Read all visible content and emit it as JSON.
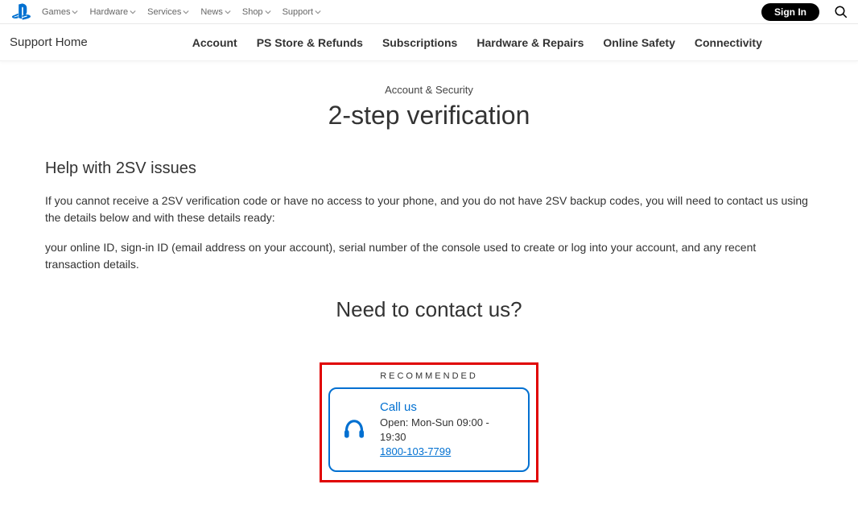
{
  "topNav": {
    "items": [
      "Games",
      "Hardware",
      "Services",
      "News",
      "Shop",
      "Support"
    ],
    "signIn": "Sign In"
  },
  "subNav": {
    "home": "Support Home",
    "items": [
      "Account",
      "PS Store & Refunds",
      "Subscriptions",
      "Hardware & Repairs",
      "Online Safety",
      "Connectivity"
    ]
  },
  "breadcrumb": "Account & Security",
  "pageTitle": "2-step verification",
  "section": {
    "heading": "Help with 2SV issues",
    "p1": "If you cannot receive a 2SV verification code or have no access to your phone, and you do not have 2SV backup codes, you will need to contact us using the details below and with these details ready:",
    "p2": "your online ID, sign-in ID (email address on your account), serial number of the console used to create or log into your account, and any recent transaction details."
  },
  "contact": {
    "heading": "Need to contact us?",
    "recommended": "RECOMMENDED",
    "title": "Call us",
    "hours": "Open: Mon-Sun 09:00 - 19:30",
    "phone": "1800-103-7799"
  }
}
